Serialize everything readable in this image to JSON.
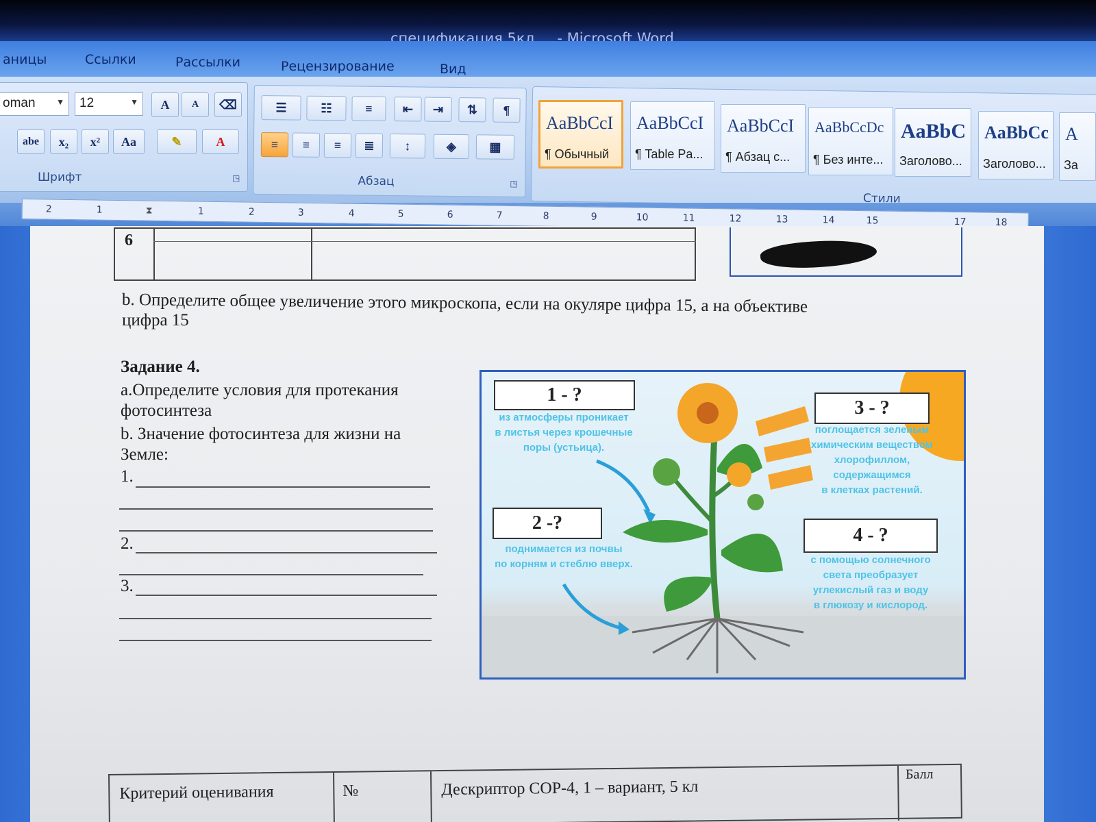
{
  "window": {
    "title": "спецификация 5кл ... - Microsoft Word"
  },
  "tabs": [
    {
      "label": "аницы"
    },
    {
      "label": "Ссылки"
    },
    {
      "label": "Рассылки"
    },
    {
      "label": "Рецензирование"
    },
    {
      "label": "Вид"
    }
  ],
  "font_group": {
    "font_name": "oman",
    "font_size": "12",
    "label": "Шрифт",
    "grow": "A",
    "shrink": "A",
    "strike": "abe",
    "subscript": "x₂",
    "superscript": "x²",
    "change_case": "Aa",
    "font_color": "A"
  },
  "paragraph_group": {
    "label": "Абзац",
    "pilcrow": "¶"
  },
  "styles_group": {
    "label": "Стили",
    "tiles": [
      {
        "sample": "AaBbCcI",
        "name": "¶ Обычный"
      },
      {
        "sample": "AaBbCcI",
        "name": "¶ Table Pa..."
      },
      {
        "sample": "AaBbCcI",
        "name": "¶ Абзац с..."
      },
      {
        "sample": "AaBbCcDc",
        "name": "¶ Без инте..."
      },
      {
        "sample": "AaBbC",
        "name": "Заголово..."
      },
      {
        "sample": "AaBbCc",
        "name": "Заголово..."
      },
      {
        "sample": "A",
        "name": "За"
      }
    ]
  },
  "ruler": {
    "ticks": [
      "2",
      "1",
      "1",
      "2",
      "3",
      "4",
      "5",
      "6",
      "7",
      "8",
      "9",
      "10",
      "11",
      "12",
      "13",
      "14",
      "15",
      "17",
      "18"
    ]
  },
  "document": {
    "table_row_number": "6",
    "question_b_line1": "b. Определите общее увеличение этого микроскопа, если на окуляре цифра 15, а на объективе",
    "question_b_line2": "цифра 15",
    "task_title": "Задание 4.",
    "task_a_line1": "а.Определите   условия   для   протекания",
    "task_a_line2": "фотосинтеза",
    "task_b_line1": "b.  Значение   фотосинтеза   для   жизни   на",
    "task_b_line2": "Земле:",
    "answer_1": "1.",
    "answer_2": "2.",
    "answer_3": "3."
  },
  "figure": {
    "box1": "1 - ?",
    "box2": "2 -?",
    "box3": "3 - ?",
    "box4": "4 - ?",
    "caption1": "из атмосферы проникает\nв листья через крошечные\nпоры (устьица).",
    "caption2": "поднимается из почвы\nпо корням и стеблю вверх.",
    "caption3": "поглощается зеленым\nхимическим веществом\nхлорофиллом,\nсодержащимся\nв клетках растений.",
    "caption4": "с помощью солнечного\nсвета преобразует\nуглекислый газ и воду\nв глюкозу и кислород."
  },
  "bottom_table": {
    "col1": "Критерий оценивания",
    "col2": "№",
    "col3": "Дескриптор СОР-4, 1 – вариант, 5 кл",
    "col4": "Балл"
  },
  "colors": {
    "ribbon_blue": "#3f7fe0",
    "selected_style": "#f2a23b",
    "caption_cyan": "#4ec3e6",
    "figure_border": "#2e5fbf"
  }
}
